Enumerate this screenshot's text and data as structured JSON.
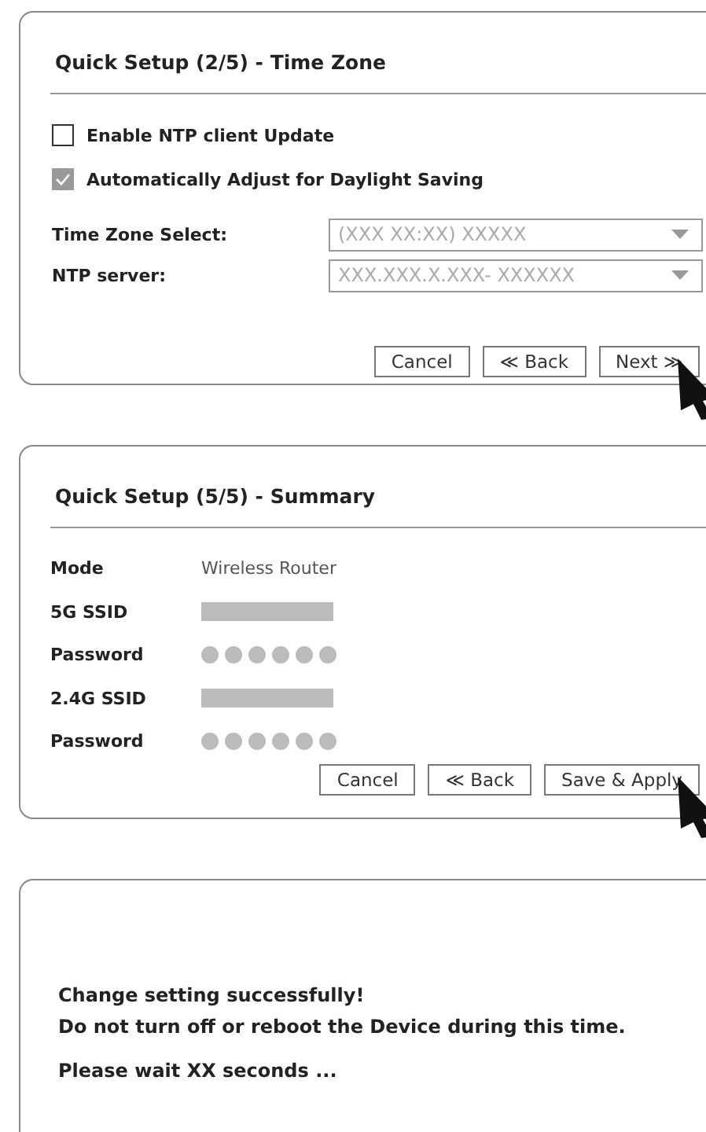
{
  "time_zone_panel": {
    "title": "Quick Setup (2/5) - Time Zone",
    "checkboxes": [
      {
        "label": "Enable NTP client Update",
        "checked": false
      },
      {
        "label": "Automatically Adjust for Daylight Saving",
        "checked": true
      }
    ],
    "fields": [
      {
        "label": "Time Zone Select:",
        "value": "(XXX XX:XX) XXXXX"
      },
      {
        "label": "NTP server:",
        "value": "XXX.XXX.X.XXX- XXXXXX"
      }
    ],
    "buttons": [
      "Cancel",
      "≪ Back",
      "Next ≫"
    ]
  },
  "summary_panel": {
    "title": "Quick Setup (5/5) - Summary",
    "rows": [
      {
        "label": "Mode",
        "kind": "text",
        "value": "Wireless Router"
      },
      {
        "label": "5G SSID",
        "kind": "bar"
      },
      {
        "label": "Password",
        "kind": "dots"
      },
      {
        "label": "2.4G SSID",
        "kind": "bar"
      },
      {
        "label": "Password",
        "kind": "dots"
      }
    ],
    "buttons": [
      "Cancel",
      "≪ Back",
      "Save & Apply"
    ]
  },
  "message_panel": {
    "lines": [
      "Change setting successfully!",
      "Do not turn off or reboot the Device during this time."
    ],
    "wait_text": "Please wait XX seconds ..."
  }
}
